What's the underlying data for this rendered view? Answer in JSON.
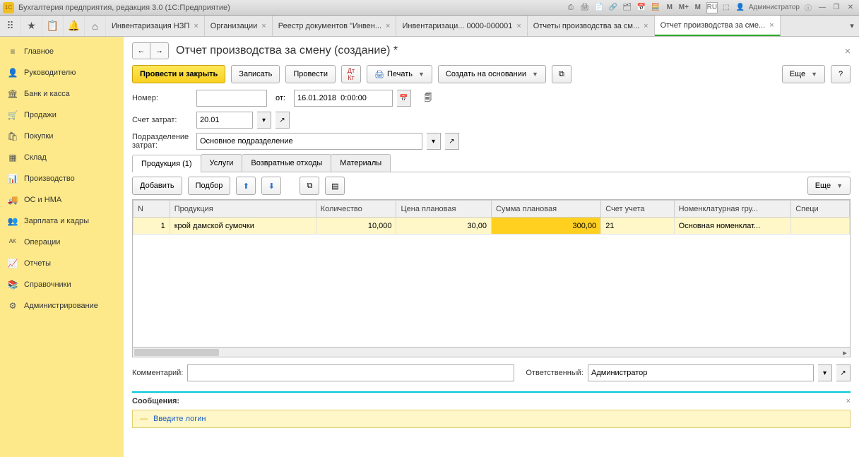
{
  "app": {
    "title": "Бухгалтерия предприятия, редакция 3.0  (1С:Предприятие)",
    "user": "Администратор"
  },
  "tabs": [
    {
      "label": "Инвентаризация НЗП"
    },
    {
      "label": "Организации"
    },
    {
      "label": "Реестр документов \"Инвен..."
    },
    {
      "label": "Инвентаризаци... 0000-000001"
    },
    {
      "label": "Отчеты производства за см..."
    },
    {
      "label": "Отчет производства за сме...",
      "active": true
    }
  ],
  "sidebar": [
    {
      "icon": "≡",
      "label": "Главное"
    },
    {
      "icon": "👤",
      "label": "Руководителю"
    },
    {
      "icon": "🏛",
      "label": "Банк и касса"
    },
    {
      "icon": "🛒",
      "label": "Продажи"
    },
    {
      "icon": "🛍",
      "label": "Покупки"
    },
    {
      "icon": "▦",
      "label": "Склад"
    },
    {
      "icon": "📊",
      "label": "Производство"
    },
    {
      "icon": "🚚",
      "label": "ОС и НМА"
    },
    {
      "icon": "👥",
      "label": "Зарплата и кадры"
    },
    {
      "icon": "ᴬᴷ",
      "label": "Операции"
    },
    {
      "icon": "📈",
      "label": "Отчеты"
    },
    {
      "icon": "📚",
      "label": "Справочники"
    },
    {
      "icon": "⚙",
      "label": "Администрирование"
    }
  ],
  "page": {
    "title": "Отчет производства за смену (создание) *",
    "buttons": {
      "post_close": "Провести и закрыть",
      "save": "Записать",
      "post": "Провести",
      "print": "Печать",
      "create_based": "Создать на основании",
      "more": "Еще"
    },
    "labels": {
      "number": "Номер:",
      "from": "от:",
      "cost_account": "Счет затрат:",
      "subdiv": "Подразделение затрат:",
      "comment": "Комментарий:",
      "responsible": "Ответственный:",
      "messages": "Сообщения:",
      "login_msg": "Введите логин"
    },
    "fields": {
      "number": "",
      "date": "16.01.2018  0:00:00",
      "cost_account": "20.01",
      "subdiv": "Основное подразделение",
      "comment": "",
      "responsible": "Администратор"
    }
  },
  "tabs2": [
    {
      "label": "Продукция (1)",
      "active": true
    },
    {
      "label": "Услуги"
    },
    {
      "label": "Возвратные отходы"
    },
    {
      "label": "Материалы"
    }
  ],
  "gridtools": {
    "add": "Добавить",
    "pick": "Подбор",
    "more": "Еще"
  },
  "grid": {
    "cols": [
      "N",
      "Продукция",
      "Количество",
      "Цена плановая",
      "Сумма плановая",
      "Счет учета",
      "Номенклатурная гру...",
      "Специ"
    ],
    "rows": [
      {
        "n": "1",
        "product": "крой дамской сумочки",
        "qty": "10,000",
        "price": "30,00",
        "sum": "300,00",
        "account": "21",
        "group": "Основная номенклат...",
        "spec": ""
      }
    ]
  }
}
